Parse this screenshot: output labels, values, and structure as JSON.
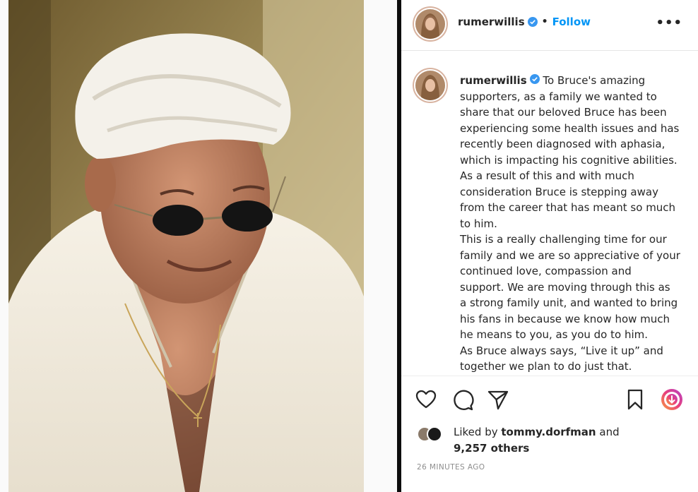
{
  "post": {
    "username": "rumerwillis",
    "follow_label": "Follow",
    "separator": "•",
    "more_label": "•••"
  },
  "caption": {
    "username": "rumerwillis",
    "lines": [
      "To Bruce's amazing",
      "supporters, as a family we wanted to",
      "share that our beloved Bruce has been",
      "experiencing some health issues and has",
      "recently been diagnosed with aphasia,",
      "which is impacting his cognitive abilities.",
      "As a result of this and with much",
      "consideration Bruce is stepping away",
      "from the career that has meant so much",
      "to him.",
      "This is a really challenging time for our",
      "family and we are so appreciative of your",
      "continued love, compassion and",
      "support. We are moving through this as",
      "a strong family unit, and wanted to bring",
      "his fans in because we know how much",
      "he means to you, as you do to him.",
      "As Bruce always says, “Live it up” and",
      "together we plan to do just that."
    ]
  },
  "actions": {
    "icons": [
      "heart-icon",
      "comment-icon",
      "share-icon",
      "bookmark-icon",
      "reel-download-icon"
    ]
  },
  "likes": {
    "prefix": "Liked by ",
    "liker": "tommy.dorfman",
    "connector": " and",
    "others": "9,257 others"
  },
  "timestamp": "26 MINUTES AGO",
  "colors": {
    "accent": "#0095f6",
    "text": "#262626",
    "muted": "#8e8e8e",
    "verified": "#3897f0"
  }
}
